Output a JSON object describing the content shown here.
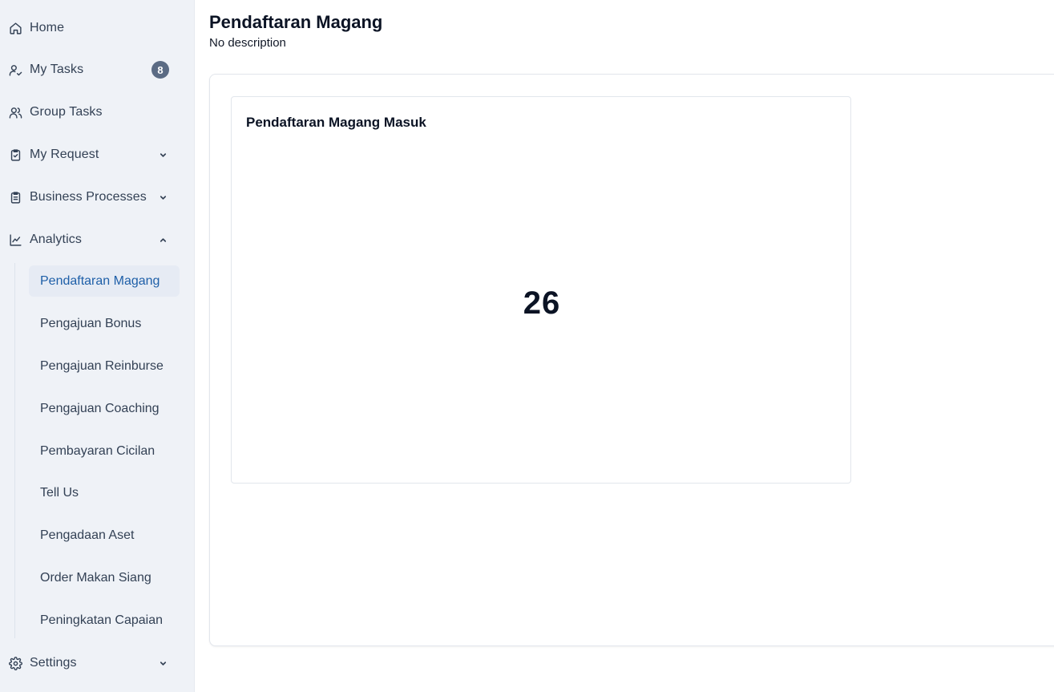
{
  "sidebar": {
    "home": "Home",
    "my_tasks": "My Tasks",
    "my_tasks_badge": "8",
    "group_tasks": "Group Tasks",
    "my_request": "My Request",
    "business_processes": "Business Processes",
    "analytics": "Analytics",
    "analytics_items": [
      "Pendaftaran Magang",
      "Pengajuan Bonus",
      "Pengajuan Reinburse",
      "Pengajuan Coaching",
      "Pembayaran Cicilan",
      "Tell Us",
      "Pengadaan Aset",
      "Order Makan Siang",
      "Peningkatan Capaian"
    ],
    "settings": "Settings"
  },
  "page": {
    "title": "Pendaftaran Magang",
    "description": "No description"
  },
  "widget": {
    "title": "Pendaftaran Magang Masuk",
    "value": "26"
  },
  "colors": {
    "sidebar_bg": "#eff2f7",
    "active_text": "#1e5fa8",
    "badge_bg": "#5b6b84"
  }
}
